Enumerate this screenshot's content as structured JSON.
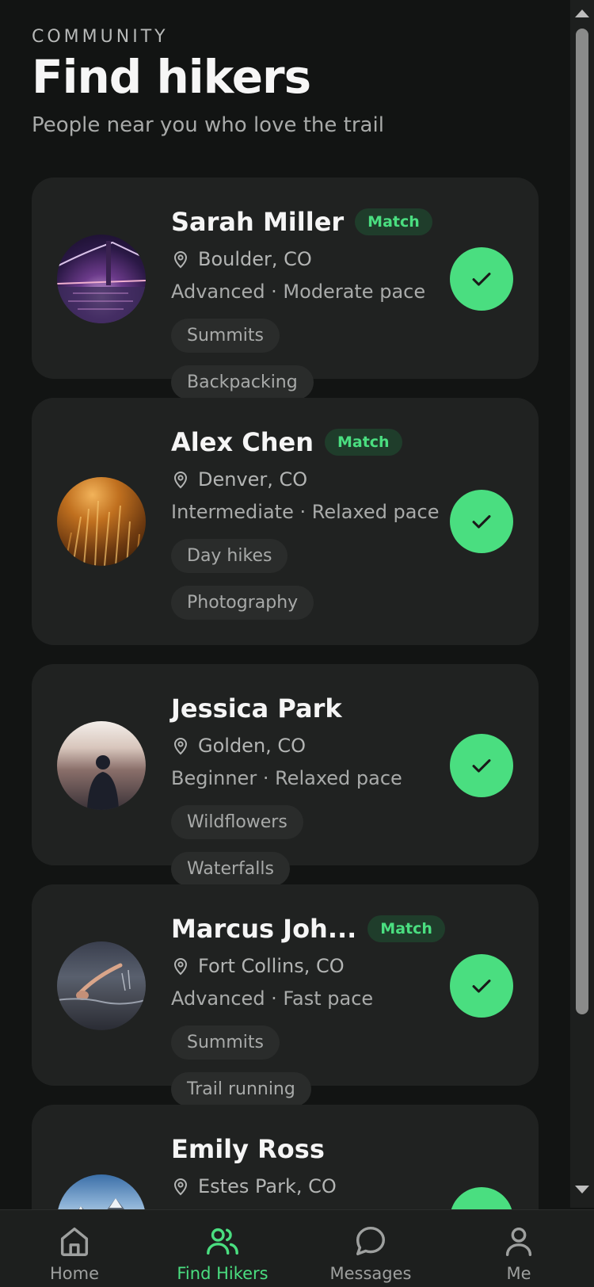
{
  "header": {
    "eyebrow": "COMMUNITY",
    "title": "Find hikers",
    "subtitle": "People near you who love the trail"
  },
  "colors": {
    "accent": "#4ade80",
    "background": "#121413",
    "card": "#202221"
  },
  "hikers": [
    {
      "name": "Sarah Miller",
      "badge": "Match",
      "location": "Boulder, CO",
      "meta": "Advanced · Moderate pace",
      "tags": [
        "Summits",
        "Backpacking"
      ]
    },
    {
      "name": "Alex Chen",
      "badge": "Match",
      "location": "Denver, CO",
      "meta": "Intermediate · Relaxed pace",
      "tags": [
        "Day hikes",
        "Photography"
      ]
    },
    {
      "name": "Jessica Park",
      "location": "Golden, CO",
      "meta": "Beginner · Relaxed pace",
      "tags": [
        "Wildflowers",
        "Waterfalls"
      ]
    },
    {
      "name": "Marcus Joh...",
      "badge": "Match",
      "location": "Fort Collins, CO",
      "meta": "Advanced · Fast pace",
      "tags": [
        "Summits",
        "Trail running"
      ]
    },
    {
      "name": "Emily Ross",
      "location": "Estes Park, CO"
    }
  ],
  "tabs": [
    {
      "label": "Home",
      "icon": "home-icon"
    },
    {
      "label": "Find Hikers",
      "icon": "users-icon",
      "active": true
    },
    {
      "label": "Messages",
      "icon": "message-icon"
    },
    {
      "label": "Me",
      "icon": "user-icon"
    }
  ]
}
